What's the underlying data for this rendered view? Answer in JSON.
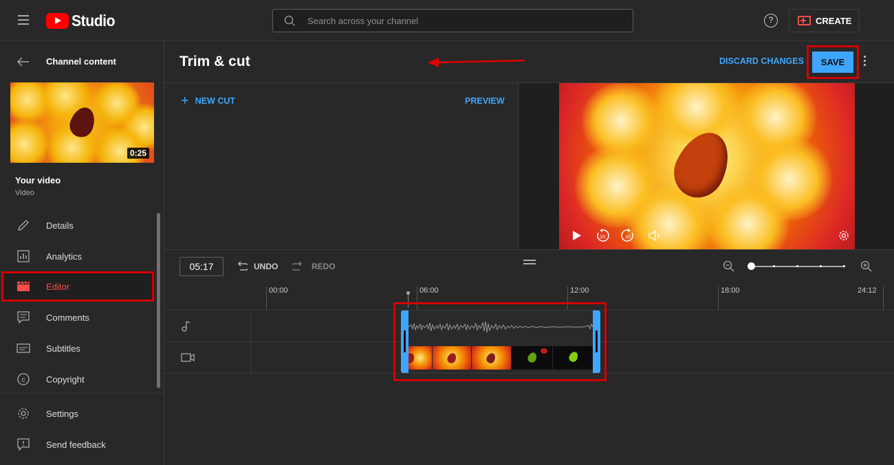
{
  "topbar": {
    "logo_text": "Studio",
    "search_placeholder": "Search across your channel",
    "help_label": "?",
    "create_label": "CREATE"
  },
  "sidebar": {
    "title": "Channel content",
    "thumbnail_duration": "0:25",
    "video_title": "Your video",
    "video_subtitle": "Video",
    "items": [
      {
        "label": "Details",
        "icon": "pencil-icon"
      },
      {
        "label": "Analytics",
        "icon": "analytics-icon"
      },
      {
        "label": "Editor",
        "icon": "clapperboard-icon",
        "active": true
      },
      {
        "label": "Comments",
        "icon": "comments-icon"
      },
      {
        "label": "Subtitles",
        "icon": "subtitles-icon"
      },
      {
        "label": "Copyright",
        "icon": "copyright-icon"
      }
    ],
    "footer_items": [
      {
        "label": "Settings",
        "icon": "gear-icon"
      },
      {
        "label": "Send feedback",
        "icon": "feedback-icon"
      }
    ]
  },
  "header": {
    "title": "Trim & cut",
    "discard_label": "DISCARD CHANGES",
    "save_label": "SAVE"
  },
  "cut_panel": {
    "new_cut_label": "NEW CUT",
    "preview_label": "PREVIEW"
  },
  "player": {
    "controls": [
      "play-icon",
      "rewind-10-icon",
      "forward-10-icon",
      "volume-icon",
      "settings-icon"
    ]
  },
  "timeline": {
    "current_time": "05:17",
    "undo_label": "UNDO",
    "redo_label": "REDO",
    "ruler_labels": [
      "00:00",
      "06:00",
      "12:00",
      "18:00",
      "24:12"
    ],
    "tracks": [
      "audio-track",
      "video-track"
    ]
  },
  "colors": {
    "accent": "#3ea6ff",
    "brand_red": "#ff0000",
    "highlight_red": "#d40000",
    "active_nav": "#ff4e45",
    "background": "#282828"
  }
}
